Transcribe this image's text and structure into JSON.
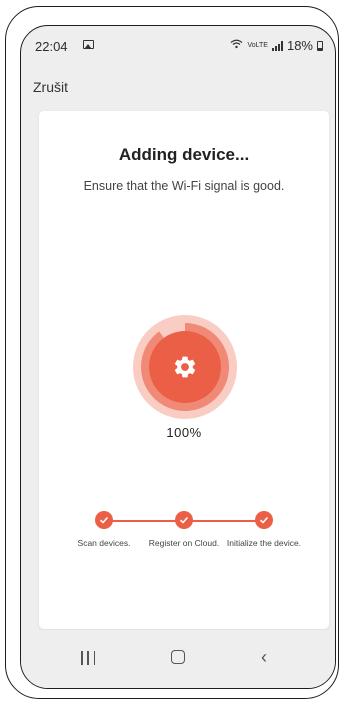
{
  "status_bar": {
    "time": "22:04",
    "network_label": "VoLTE",
    "battery": "18%",
    "icons": [
      "gallery-icon",
      "wifi-icon",
      "signal-icon",
      "battery-icon"
    ]
  },
  "header": {
    "cancel_label": "Zrušit"
  },
  "card": {
    "title": "Adding device...",
    "subtitle": "Ensure that the Wi-Fi signal is good.",
    "progress": {
      "value": 100,
      "label": "100%"
    },
    "steps": [
      {
        "label": "Scan devices.",
        "done": true
      },
      {
        "label": "Register on Cloud.",
        "done": true
      },
      {
        "label": "Initialize the device.",
        "done": true
      }
    ]
  },
  "colors": {
    "accent": "#ec5f47",
    "accent_light": "#f6b1a4",
    "accent_inner": "#f1836f",
    "background": "#eeeeee",
    "card": "#ffffff"
  },
  "nav": {
    "icons": [
      "recents-icon",
      "home-icon",
      "back-icon"
    ]
  }
}
